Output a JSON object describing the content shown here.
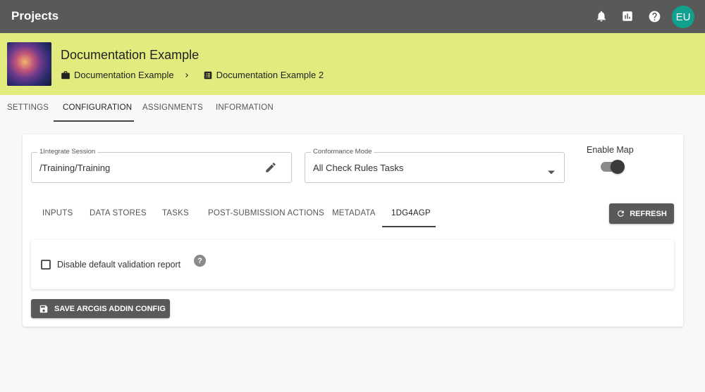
{
  "app": {
    "title": "Projects",
    "user_initials": "EU"
  },
  "icons": {
    "notifications": "bell-icon",
    "reports": "bar-chart-icon",
    "help": "help-circle-icon"
  },
  "project": {
    "title": "Documentation Example",
    "breadcrumb": [
      {
        "label": "Documentation Example",
        "icon": "briefcase-icon"
      },
      {
        "label": "Documentation Example 2",
        "icon": "list-alt-icon"
      }
    ]
  },
  "main_tabs": [
    "SETTINGS",
    "CONFIGURATION",
    "ASSIGNMENTS",
    "INFORMATION"
  ],
  "main_tab_active": "CONFIGURATION",
  "config": {
    "session": {
      "label": "1Integrate Session",
      "value": "/Training/Training"
    },
    "conformance": {
      "label": "Conformance Mode",
      "value": "All Check Rules Tasks"
    },
    "enable_map": {
      "label": "Enable Map",
      "on": true
    }
  },
  "sub_tabs": [
    "INPUTS",
    "DATA STORES",
    "TASKS",
    "POST-SUBMISSION ACTIONS",
    "METADATA",
    "1DG4AGP"
  ],
  "sub_tab_active": "1DG4AGP",
  "refresh_label": "REFRESH",
  "panel": {
    "checkbox_label": "Disable default validation report",
    "checked": false,
    "help_glyph": "?"
  },
  "save_label": "SAVE ARCGIS ADDIN CONFIG",
  "colors": {
    "topbar": "#595959",
    "header": "#e2eb7e",
    "avatar": "#12a08e",
    "button": "#595959"
  }
}
